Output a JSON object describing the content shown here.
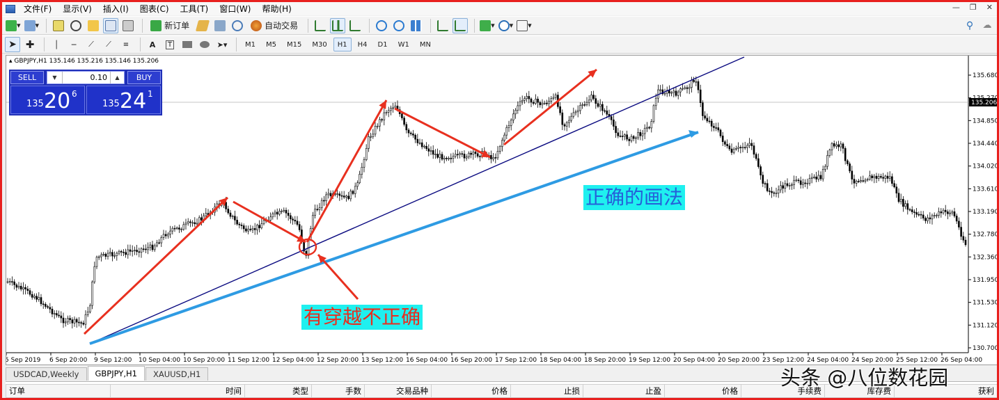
{
  "menu": {
    "items": [
      "文件(F)",
      "显示(V)",
      "插入(I)",
      "图表(C)",
      "工具(T)",
      "窗口(W)",
      "帮助(H)"
    ]
  },
  "toolbar": {
    "new_order": "新订单",
    "auto_trade": "自动交易",
    "timeframes": [
      "M1",
      "M5",
      "M15",
      "M30",
      "H1",
      "H4",
      "D1",
      "W1",
      "MN"
    ],
    "active_timeframe": "H1"
  },
  "chart": {
    "symbol_line": "GBPJPY,H1  135.146 135.216 135.146 135.206",
    "price_ticks": [
      "135.680",
      "135.270",
      "134.850",
      "134.440",
      "134.020",
      "133.610",
      "133.190",
      "132.780",
      "132.360",
      "131.950",
      "131.530",
      "131.120",
      "130.700"
    ],
    "current_price": "135.206",
    "time_ticks": [
      "5 Sep 2019",
      "6 Sep 20:00",
      "9 Sep 12:00",
      "10 Sep 04:00",
      "10 Sep 20:00",
      "11 Sep 12:00",
      "12 Sep 04:00",
      "12 Sep 20:00",
      "13 Sep 12:00",
      "16 Sep 04:00",
      "16 Sep 20:00",
      "17 Sep 12:00",
      "18 Sep 04:00",
      "18 Sep 20:00",
      "19 Sep 12:00",
      "20 Sep 04:00",
      "20 Sep 20:00",
      "23 Sep 12:00",
      "24 Sep 04:00",
      "24 Sep 20:00",
      "25 Sep 12:00",
      "26 Sep 04:00"
    ],
    "colors": {
      "candle": "#000000",
      "trendline": "#0a0a80",
      "correct_line": "#2e9be3",
      "arrow": "#e8301f",
      "background": "#ffffff"
    }
  },
  "trade_panel": {
    "sell_label": "SELL",
    "buy_label": "BUY",
    "lot": "0.10",
    "sell_prefix": "135",
    "sell_big": "20",
    "sell_sup": "6",
    "buy_prefix": "135",
    "buy_big": "24",
    "buy_sup": "1"
  },
  "annotations": {
    "wrong": "有穿越不正确",
    "correct": "正确的画法"
  },
  "tabs": [
    "USDCAD,Weekly",
    "GBPJPY,H1",
    "XAUUSD,H1"
  ],
  "active_tab": "GBPJPY,H1",
  "orders": {
    "headers": [
      "订单",
      "时间",
      "类型",
      "手数",
      "交易品种",
      "价格",
      "止损",
      "止盈",
      "价格",
      "手续费",
      "库存费",
      "获利"
    ]
  },
  "watermark": "头条 @八位数花园"
}
